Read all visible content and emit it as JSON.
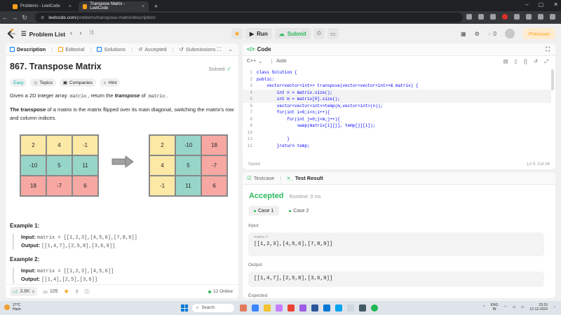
{
  "browser": {
    "tabs": [
      {
        "title": "Problems - LeetCode",
        "active": false
      },
      {
        "title": "Transpose Matrix - LeetCode",
        "active": true
      }
    ],
    "new_tab": "+",
    "url_domain": "leetcode.com",
    "url_path": "/problems/transpose-matrix/description/"
  },
  "header": {
    "problem_list": "Problem List",
    "run": "Run",
    "submit": "Submit",
    "coins": "0",
    "premium": "Premium"
  },
  "left_tabs": {
    "description": "Description",
    "editorial": "Editorial",
    "solutions": "Solutions",
    "accepted": "Accepted",
    "submissions": "Submissions"
  },
  "problem": {
    "title": "867. Transpose Matrix",
    "status": "Solved",
    "chips": {
      "difficulty": "Easy",
      "topics": "Topics",
      "companies": "Companies",
      "hint": "Hint"
    },
    "p1_a": "Given a 2D integer array ",
    "p1_code1": "matrix",
    "p1_b": ", return the ",
    "p1_em": "transpose",
    "p1_c": " of ",
    "p1_code2": "matrix",
    "p1_d": ".",
    "p2_strong": "The transpose",
    "p2_rest": " of a matrix is the matrix flipped over its main diagonal, switching the matrix's row and column indices.",
    "matrix_before": [
      [
        "2",
        "4",
        "-1"
      ],
      [
        "-10",
        "5",
        "11"
      ],
      [
        "18",
        "-7",
        "6"
      ]
    ],
    "matrix_after": [
      [
        "2",
        "-10",
        "18"
      ],
      [
        "4",
        "5",
        "-7"
      ],
      [
        "-1",
        "11",
        "6"
      ]
    ],
    "examples": [
      {
        "label": "Example 1:",
        "input_label": "Input:",
        "input": "matrix = [[1,2,3],[4,5,6],[7,8,9]]",
        "output_label": "Output:",
        "output": "[[1,4,7],[2,5,8],[3,6,9]]"
      },
      {
        "label": "Example 2:",
        "input_label": "Input:",
        "input": "matrix = [[1,2,3],[4,5,6]]",
        "output_label": "Output:",
        "output": "[[1,4],[2,5],[3,6]]"
      }
    ]
  },
  "footer": {
    "likes": "3.8K",
    "comments": "105",
    "online": "12 Online"
  },
  "code": {
    "header": "Code",
    "language": "C++",
    "mode": "Auto",
    "lines": [
      {
        "n": "1",
        "text": "class Solution {"
      },
      {
        "n": "2",
        "text": "public:"
      },
      {
        "n": "3",
        "text": "    vector<vector<int>> transpose(vector<vector<int>>& matrix) {"
      },
      {
        "n": "4",
        "text": "        int n = matrix.size();"
      },
      {
        "n": "5",
        "text": "        int m = matrix[0].size();"
      },
      {
        "n": "6",
        "text": "        vector<vector<int>>temp(m,vector<int>(n));"
      },
      {
        "n": "7",
        "text": "        for(int i=0;i<n;i++){"
      },
      {
        "n": "8",
        "text": "            for(int j=0;j<m;j++){"
      },
      {
        "n": "9",
        "text": "                swap(matrix[i][j], temp[j][i]);"
      },
      {
        "n": "10",
        "text": ""
      },
      {
        "n": "11",
        "text": "            }"
      },
      {
        "n": "12",
        "text": "        }return temp;"
      }
    ],
    "saved": "Saved",
    "cursor": "Ln 5, Col 34"
  },
  "result": {
    "testcase_tab": "Testcase",
    "testresult_tab": "Test Result",
    "status": "Accepted",
    "runtime": "Runtime: 0 ms",
    "case1": "Case 1",
    "case2": "Case 2",
    "input_label": "Input",
    "input_var": "matrix =",
    "input_value": "[[1,2,3],[4,5,6],[7,8,9]]",
    "output_label": "Output",
    "output_value": "[[1,4,7],[2,5,8],[3,6,9]]",
    "expected_label": "Expected"
  },
  "taskbar": {
    "temp": "17°C",
    "weather": "Haze",
    "search": "Search",
    "lang1": "ENG",
    "lang2": "IN",
    "time": "23:15",
    "date": "12-12-2024"
  },
  "colors": {
    "yellow": "#fce9a6",
    "teal": "#98d5c9",
    "pink": "#f7a8a2",
    "accepted": "#2cbb5d",
    "brand": "#ffa116"
  }
}
